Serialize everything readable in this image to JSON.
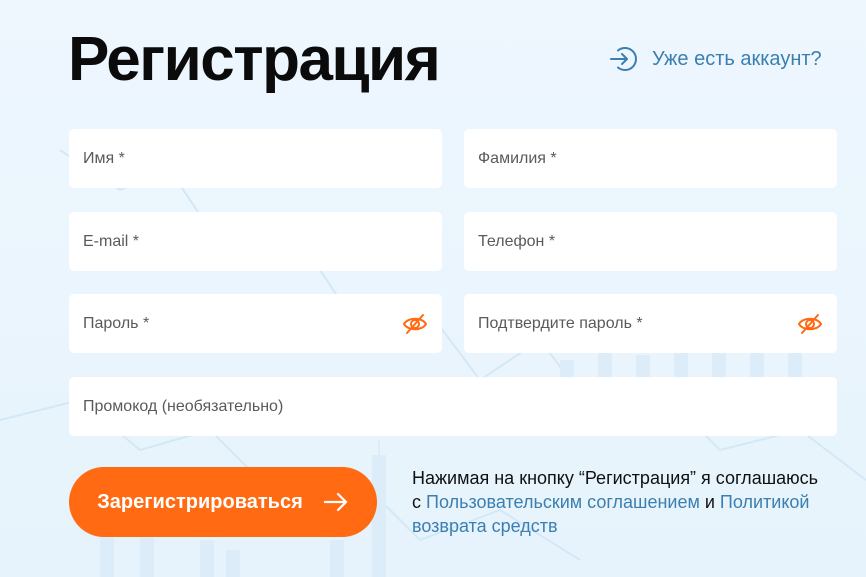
{
  "header": {
    "title": "Регистрация",
    "login_link": "Уже есть аккаунт?"
  },
  "form": {
    "first_name_placeholder": "Имя *",
    "last_name_placeholder": "Фамилия *",
    "email_placeholder": "E-mail *",
    "phone_placeholder": "Телефон *",
    "password_placeholder": "Пароль *",
    "confirm_password_placeholder": "Подтвердите пароль *",
    "promo_placeholder": "Промокод (необязательно)",
    "submit_label": "Зарегистрироваться"
  },
  "agreement": {
    "text_before": "Нажимая на кнопку “Регистрация” я соглашаюсь с ",
    "terms_link": "Пользовательским соглашением",
    "conjunction": " и ",
    "refund_link": "Политикой возврата средств"
  },
  "colors": {
    "accent": "#ff6a13",
    "link": "#3b7fb0",
    "background": "#e9f5fd"
  },
  "icons": {
    "login": "arrow-into-bracket-icon",
    "password_toggle": "eye-off-icon",
    "submit": "arrow-right-icon"
  }
}
